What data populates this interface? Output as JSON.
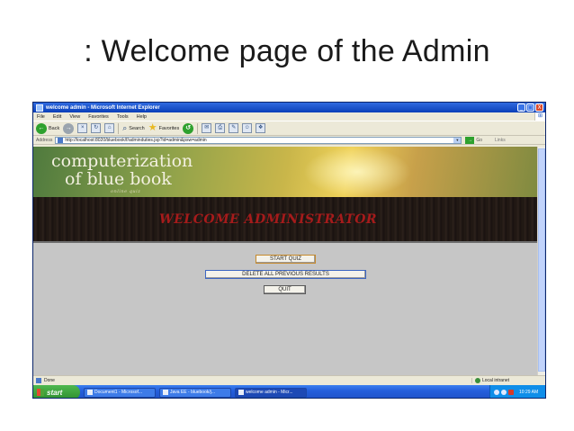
{
  "slide": {
    "title": ": Welcome page of the Admin"
  },
  "window": {
    "title": "welcome admin - Microsoft Internet Explorer",
    "controls": {
      "minimize": "_",
      "maximize": "□",
      "close": "X"
    }
  },
  "menubar": {
    "items": [
      "File",
      "Edit",
      "View",
      "Favorites",
      "Tools",
      "Help"
    ]
  },
  "toolbar": {
    "back_label": "Back",
    "search_label": "Search",
    "favorites_label": "Favorites"
  },
  "addressbar": {
    "label": "Address",
    "url": "http://localhost:8020/bluebook/f/adminduties.jsp?id=admin&psw=admin",
    "go_label": "Go",
    "links_label": "Links"
  },
  "banner": {
    "brand_line1": "computerization",
    "brand_line2": "of blue book",
    "brand_sub": "online quiz",
    "welcome": "WELCOME ADMINISTRATOR"
  },
  "actions": {
    "start": "START QUIZ",
    "delete": "DELETE ALL PREVIOUS RESULTS",
    "quit": "QUIT"
  },
  "statusbar": {
    "status": "Done",
    "zone": "Local intranet"
  },
  "taskbar": {
    "start_label": "start",
    "tasks": [
      "Document1 - Microsof...",
      "Java EE - bluebook/j...",
      "welcome admin - Micr..."
    ],
    "clock": "10:29 AM"
  },
  "colors": {
    "title_bar": "#0a3fb8",
    "welcome_text": "#a51b1b",
    "page_bg": "#c6c6c6",
    "taskbar": "#245edb"
  }
}
